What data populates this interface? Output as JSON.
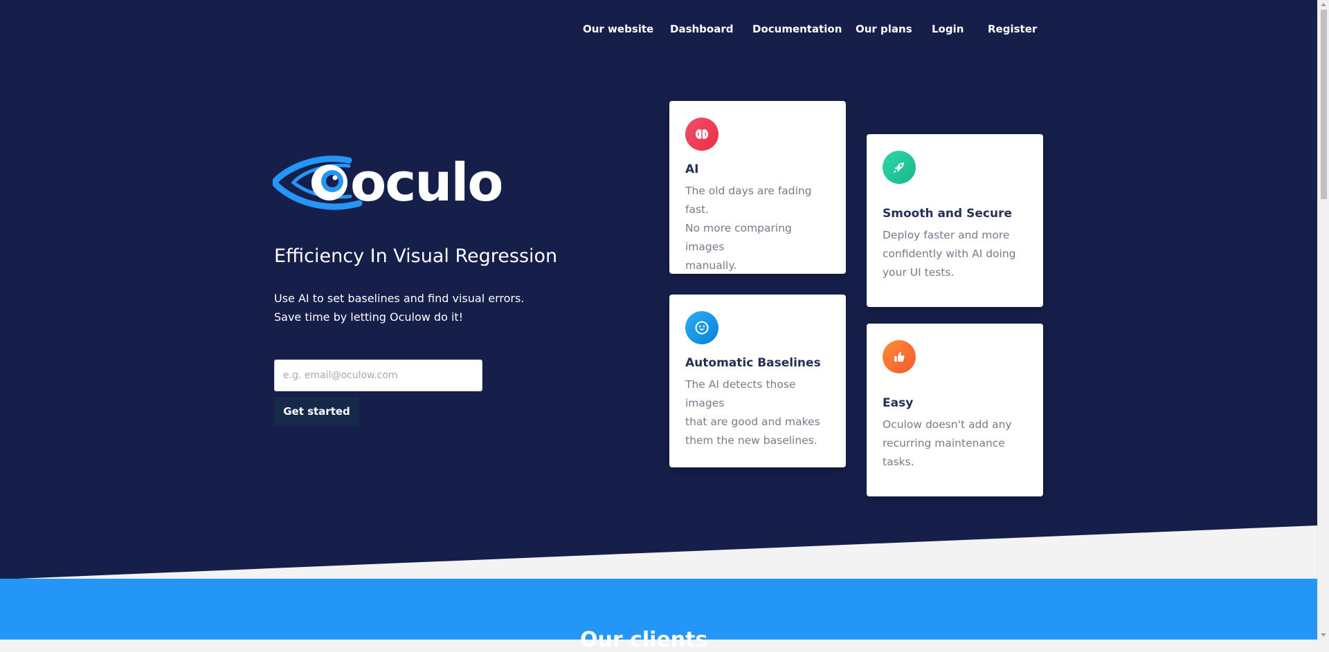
{
  "nav": {
    "items": [
      {
        "label": "Our website"
      },
      {
        "label": "Dashboard"
      },
      {
        "label": "Documentation"
      },
      {
        "label": "Our plans"
      },
      {
        "label": "Login"
      },
      {
        "label": "Register"
      }
    ]
  },
  "brand": {
    "logo_text": "oculow",
    "logo_color": "#2496f7"
  },
  "hero": {
    "tagline": "Efficiency In Visual Regression",
    "sub_line1": "Use AI to set baselines and find visual errors.",
    "sub_line2": "Save time by letting Oculow do it!",
    "email_placeholder": "e.g. email@oculow.com",
    "cta_label": "Get started",
    "background": "#151f4a"
  },
  "features": [
    {
      "icon": "brain-icon",
      "icon_colors": [
        "#f0506e",
        "#ec2e3f"
      ],
      "title": "AI",
      "line1": "The old days are fading fast.",
      "line2": "No more comparing images",
      "line3": "manually."
    },
    {
      "icon": "smiley-icon",
      "icon_colors": [
        "#2ab0f5",
        "#0b7fd9"
      ],
      "title": "Automatic Baselines",
      "line1": "The AI detects those images",
      "line2": "that are good and makes",
      "line3": "them the new baselines."
    },
    {
      "icon": "rocket-icon",
      "icon_colors": [
        "#2fd6a5",
        "#18b78e"
      ],
      "title": "Smooth and Secure",
      "line1": "Deploy faster and more",
      "line2": "confidently with AI doing",
      "line3": "your UI tests."
    },
    {
      "icon": "thumbs-up-icon",
      "icon_colors": [
        "#ff8c3a",
        "#f25a2b"
      ],
      "title": "Easy",
      "line1": "Oculow doesn't add any",
      "line2": "recurring maintenance",
      "line3": "tasks."
    }
  ],
  "section": {
    "heading": "Our clients",
    "band_color": "#2496f7"
  }
}
